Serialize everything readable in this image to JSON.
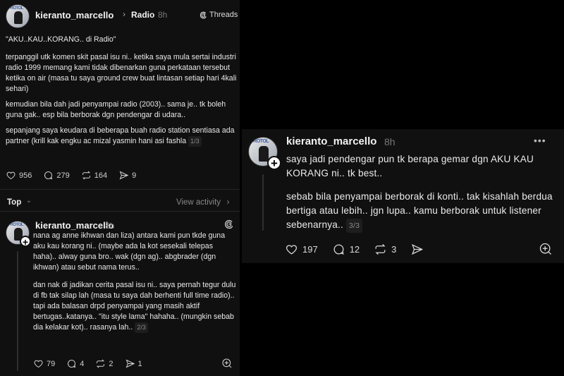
{
  "left": {
    "header": {
      "username": "kieranto_marcello",
      "chevron": "›",
      "community": "Radio",
      "time": "8h",
      "badge": "Threads",
      "badge_icon": "threads-icon"
    },
    "post": {
      "paragraphs": [
        "\"AKU..KAU..KORANG.. di Radio\"",
        "terpanggil utk komen skit pasal isu ni.. ketika saya mula sertai industri radio 1999 memang kami tidak dibenarkan guna perkataan tersebut ketika on air (masa tu saya ground crew buat lintasan setiap hari 4kali sehari)",
        "kemudian bila dah jadi penyampai radio (2003).. sama je.. tk boleh guna gak.. esp bila berborak dgn pendengar di udara..",
        "sepanjang saya keudara di beberapa buah radio station sentiasa ada partner (krill kak engku ac mizal yasmin hani asi fashla"
      ],
      "pager": "1/3",
      "likes": "956",
      "comments": "279",
      "reposts": "164",
      "shares": "9"
    },
    "replies_header": {
      "sort": "Top",
      "sort_chevron": "⌄",
      "view_activity": "View activity",
      "view_chevron": "›"
    },
    "reply": {
      "username": "kieranto_marcello",
      "time": "8h",
      "paragraphs": [
        "nana ag anne ikhwan dan liza) antara kami pun tkde guna aku kau korang ni.. (maybe ada la kot sesekali telepas haha).. alway guna bro.. wak (dgn ag).. abgbrader (dgn ikhwan)  atau sebut nama terus..",
        "dan nak di jadikan cerita pasal isu ni.. saya pernah tegur dulu di fb tak silap lah (masa tu saya dah berhenti full time radio).. tapi ada balasan drpd penyampai yang masih aktif bertugas..katanya.. \"itu style lama\" hahaha.. (mungkin sebab dia kelakar kot).. rasanya lah.."
      ],
      "pager": "2/3",
      "likes": "79",
      "comments": "4",
      "reposts": "2",
      "shares": "1"
    }
  },
  "right": {
    "username": "kieranto_marcello",
    "time": "8h",
    "more": "•••",
    "paragraphs": [
      "saya jadi pendengar pun tk berapa gemar dgn AKU KAU KORANG ni.. tk best..",
      "sebab bila penyampai berborak di konti.. tak kisahlah berdua bertiga atau lebih.. jgn lupa.. kamu berborak untuk listener sebenarnya.."
    ],
    "pager": "3/3",
    "likes": "197",
    "comments": "12",
    "reposts": "3"
  },
  "avatar_text": "PROTOL",
  "plus": "+"
}
